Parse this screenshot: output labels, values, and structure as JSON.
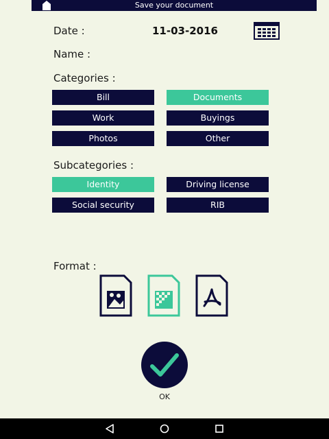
{
  "header": {
    "title": "Save your document",
    "home_icon": "home-icon"
  },
  "form": {
    "date_label": "Date :",
    "date_value": "11-03-2016",
    "calendar_icon": "calendar-icon",
    "name_label": "Name :",
    "categories_label": "Categories :",
    "categories": [
      {
        "label": "Bill",
        "selected": false
      },
      {
        "label": "Documents",
        "selected": true
      },
      {
        "label": "Work",
        "selected": false
      },
      {
        "label": "Buyings",
        "selected": false
      },
      {
        "label": "Photos",
        "selected": false
      },
      {
        "label": "Other",
        "selected": false
      }
    ],
    "subcategories_label": "Subcategories :",
    "subcategories": [
      {
        "label": "Identity",
        "selected": true
      },
      {
        "label": "Driving license",
        "selected": false
      },
      {
        "label": "Social security",
        "selected": false
      },
      {
        "label": "RIB",
        "selected": false
      }
    ],
    "format_label": "Format :",
    "formats": [
      {
        "icon": "image-file-icon",
        "selected": false
      },
      {
        "icon": "scan-file-icon",
        "selected": true
      },
      {
        "icon": "pdf-file-icon",
        "selected": false
      }
    ],
    "ok_label": "OK"
  },
  "nav": {
    "back_icon": "back-icon",
    "home_icon": "home-circle-icon",
    "recents_icon": "recents-icon"
  },
  "colors": {
    "dark": "#0c0c3a",
    "accent": "#3cc79a",
    "background": "#f2f5e6"
  }
}
